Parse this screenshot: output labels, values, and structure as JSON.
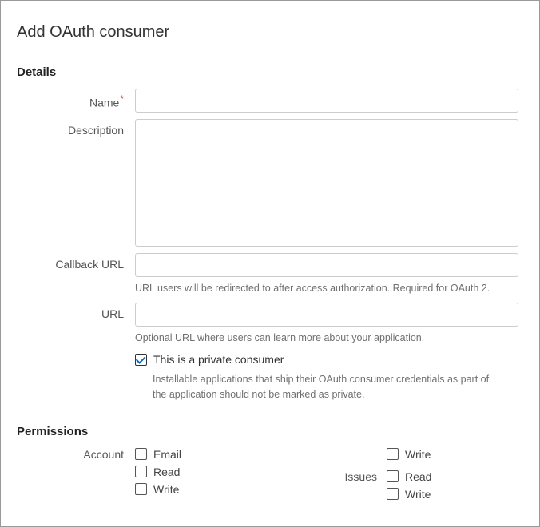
{
  "page_title": "Add OAuth consumer",
  "sections": {
    "details_title": "Details",
    "permissions_title": "Permissions"
  },
  "fields": {
    "name": {
      "label": "Name",
      "required_mark": "*",
      "value": ""
    },
    "description": {
      "label": "Description",
      "value": ""
    },
    "callback_url": {
      "label": "Callback URL",
      "value": "",
      "help": "URL users will be redirected to after access authorization. Required for OAuth 2."
    },
    "url": {
      "label": "URL",
      "value": "",
      "help": "Optional URL where users can learn more about your application."
    },
    "private_consumer": {
      "checked": true,
      "label": "This is a private consumer",
      "help": "Installable applications that ship their OAuth consumer credentials as part of the application should not be marked as private."
    }
  },
  "permissions": {
    "left": {
      "group_label": "Account",
      "items": [
        {
          "label": "Email",
          "checked": false
        },
        {
          "label": "Read",
          "checked": false
        },
        {
          "label": "Write",
          "checked": false
        }
      ]
    },
    "right_top": {
      "items": [
        {
          "label": "Write",
          "checked": false
        }
      ]
    },
    "right_issues": {
      "group_label": "Issues",
      "items": [
        {
          "label": "Read",
          "checked": false
        },
        {
          "label": "Write",
          "checked": false
        }
      ]
    }
  }
}
